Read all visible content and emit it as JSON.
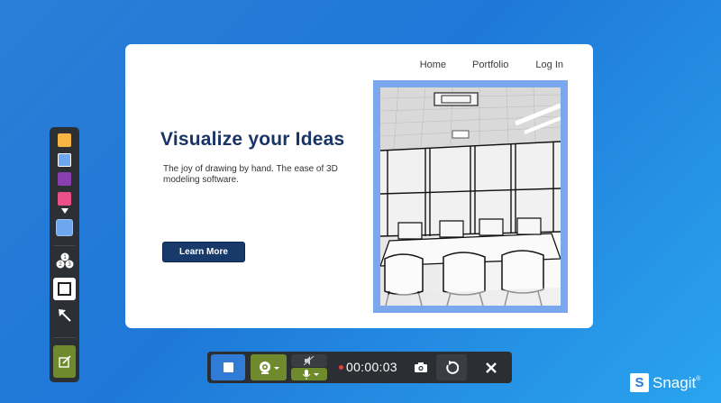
{
  "website": {
    "nav": {
      "home": "Home",
      "portfolio": "Portfolio",
      "login": "Log In"
    },
    "headline": "Visualize your Ideas",
    "tagline": "The joy of drawing by hand. The ease of 3D modeling software.",
    "cta": "Learn More",
    "image": "office-sketch-photo"
  },
  "tools": {
    "swatches": [
      "#f7b643",
      "#6ea7ee",
      "#8a3fb0",
      "#ea4f8b"
    ],
    "selected_color": "#6ea7ee",
    "step_icon_label": "123"
  },
  "recorder": {
    "timer": "00:00:03",
    "webcam_color": "#6e8a2c",
    "stop_color": "#2f7bd6"
  },
  "brand": {
    "name": "Snagit",
    "mark": "S",
    "reg": "®"
  },
  "colors": {
    "accent": "#1f78d8",
    "headline": "#1a3466",
    "button": "#173a6b",
    "toolbar": "#2c2f33",
    "green": "#6e8a2c"
  }
}
